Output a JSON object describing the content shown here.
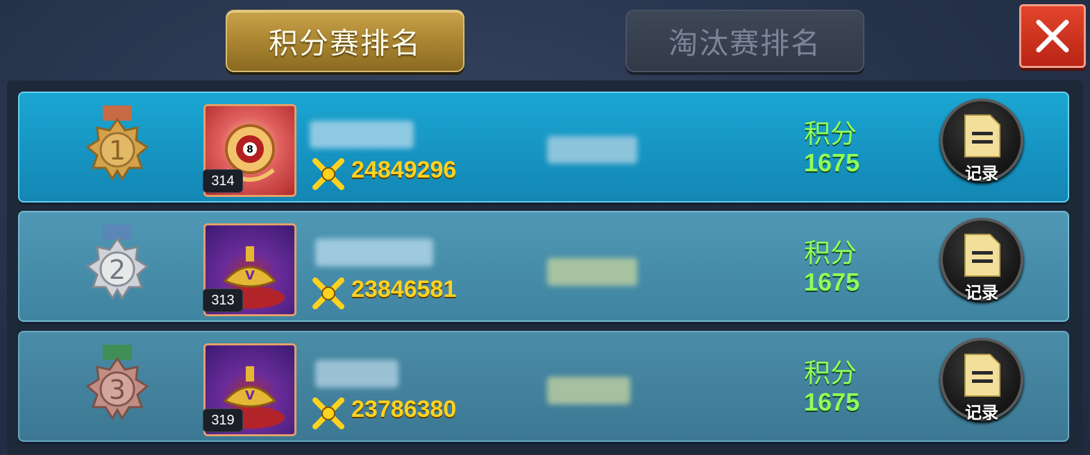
{
  "tabs": [
    {
      "label": "积分赛排名",
      "active": true
    },
    {
      "label": "淘汰赛排名",
      "active": false
    }
  ],
  "close_icon": "close-icon",
  "rows": [
    {
      "rank": "1",
      "medal_color": "#d4a24a",
      "ribbon_color": "#c86a46",
      "level": "314",
      "power": "24849296",
      "score_label": "积分",
      "score": "1675",
      "record_label": "记录"
    },
    {
      "rank": "2",
      "medal_color": "#cfd2d6",
      "ribbon_color": "#5a86b8",
      "level": "313",
      "power": "23846581",
      "score_label": "积分",
      "score": "1675",
      "record_label": "记录"
    },
    {
      "rank": "3",
      "medal_color": "#c08e83",
      "ribbon_color": "#3f8f57",
      "level": "319",
      "power": "23786380",
      "score_label": "积分",
      "score": "1675",
      "record_label": "记录"
    }
  ],
  "colors": {
    "accent_gold": "#c9a24a",
    "score_green": "#8fff5a",
    "power_yellow": "#ffd21f",
    "close_red": "#d9391f"
  }
}
